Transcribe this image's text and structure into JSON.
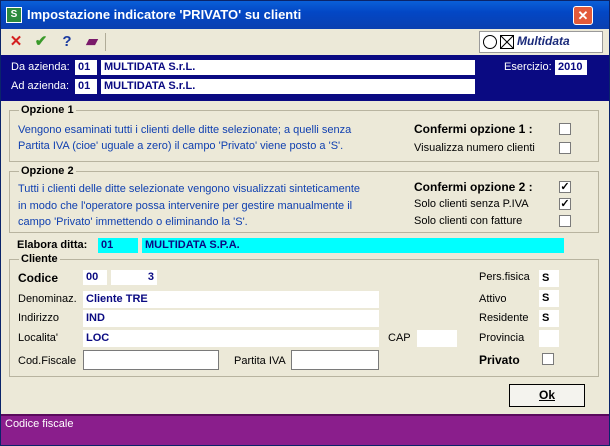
{
  "window": {
    "title": "Impostazione indicatore 'PRIVATO' su clienti",
    "app_icon_glyph": "S",
    "close_glyph": "✕"
  },
  "toolbar": {
    "cancel_glyph": "✕",
    "confirm_glyph": "✔",
    "help_glyph": "?",
    "book_glyph": "▰",
    "logo_text": "Multidata"
  },
  "header": {
    "da_label": "Da azienda:",
    "da_code": "01",
    "da_name": "MULTIDATA S.r.L.",
    "ad_label": "Ad azienda:",
    "ad_code": "01",
    "ad_name": "MULTIDATA S.r.L.",
    "esercizio_label": "Esercizio:",
    "esercizio_value": "2010"
  },
  "opzione1": {
    "title": "Opzione 1",
    "desc_line1": "Vengono esaminati tutti i clienti delle ditte selezionate; a quelli senza",
    "desc_line2": "Partita IVA (cioe' uguale a zero) il campo 'Privato' viene posto a 'S'.",
    "confirm_label": "Confermi opzione 1 :",
    "confirm_checked": false,
    "show_count_label": "Visualizza numero clienti",
    "show_count_checked": false
  },
  "opzione2": {
    "title": "Opzione 2",
    "desc_line1": "Tutti i clienti delle ditte selezionate vengono visualizzati sinteticamente",
    "desc_line2": "in modo che l'operatore possa intervenire per gestire manualmente il",
    "desc_line3": "campo 'Privato' immettendo o eliminando la 'S'.",
    "confirm_label": "Confermi opzione 2 :",
    "confirm_checked": true,
    "no_piva_label": "Solo clienti senza P.IVA",
    "no_piva_checked": true,
    "with_invoices_label": "Solo clienti con fatture",
    "with_invoices_checked": false
  },
  "elabora": {
    "label": "Elabora ditta:",
    "code": "01",
    "name": "MULTIDATA S.P.A.",
    "highlight_color": "#00ffff"
  },
  "cliente": {
    "title": "Cliente",
    "codice_label": "Codice",
    "codice_prefix": "00",
    "codice_number": "3",
    "denominaz_label": "Denominaz.",
    "denominaz_value": "Cliente TRE",
    "indirizzo_label": "Indirizzo",
    "indirizzo_value": "IND",
    "localita_label": "Localita'",
    "localita_value": "LOC",
    "cap_label": "CAP",
    "cap_value": "",
    "codfiscale_label": "Cod.Fiscale",
    "codfiscale_value": "",
    "partitaiva_label": "Partita IVA",
    "partitaiva_value": "",
    "persfisica_label": "Pers.fisica",
    "persfisica_value": "S",
    "attivo_label": "Attivo",
    "attivo_value": "S",
    "residente_label": "Residente",
    "residente_value": "S",
    "provincia_label": "Provincia",
    "provincia_value": "",
    "privato_label": "Privato",
    "privato_checked": false
  },
  "ok_button": {
    "label": "Ok"
  },
  "status_bar": {
    "text": "Codice fiscale"
  },
  "colors": {
    "header_band": "#0a0a82",
    "status_bar": "#8a1e8c",
    "description_text": "#1040b0"
  }
}
